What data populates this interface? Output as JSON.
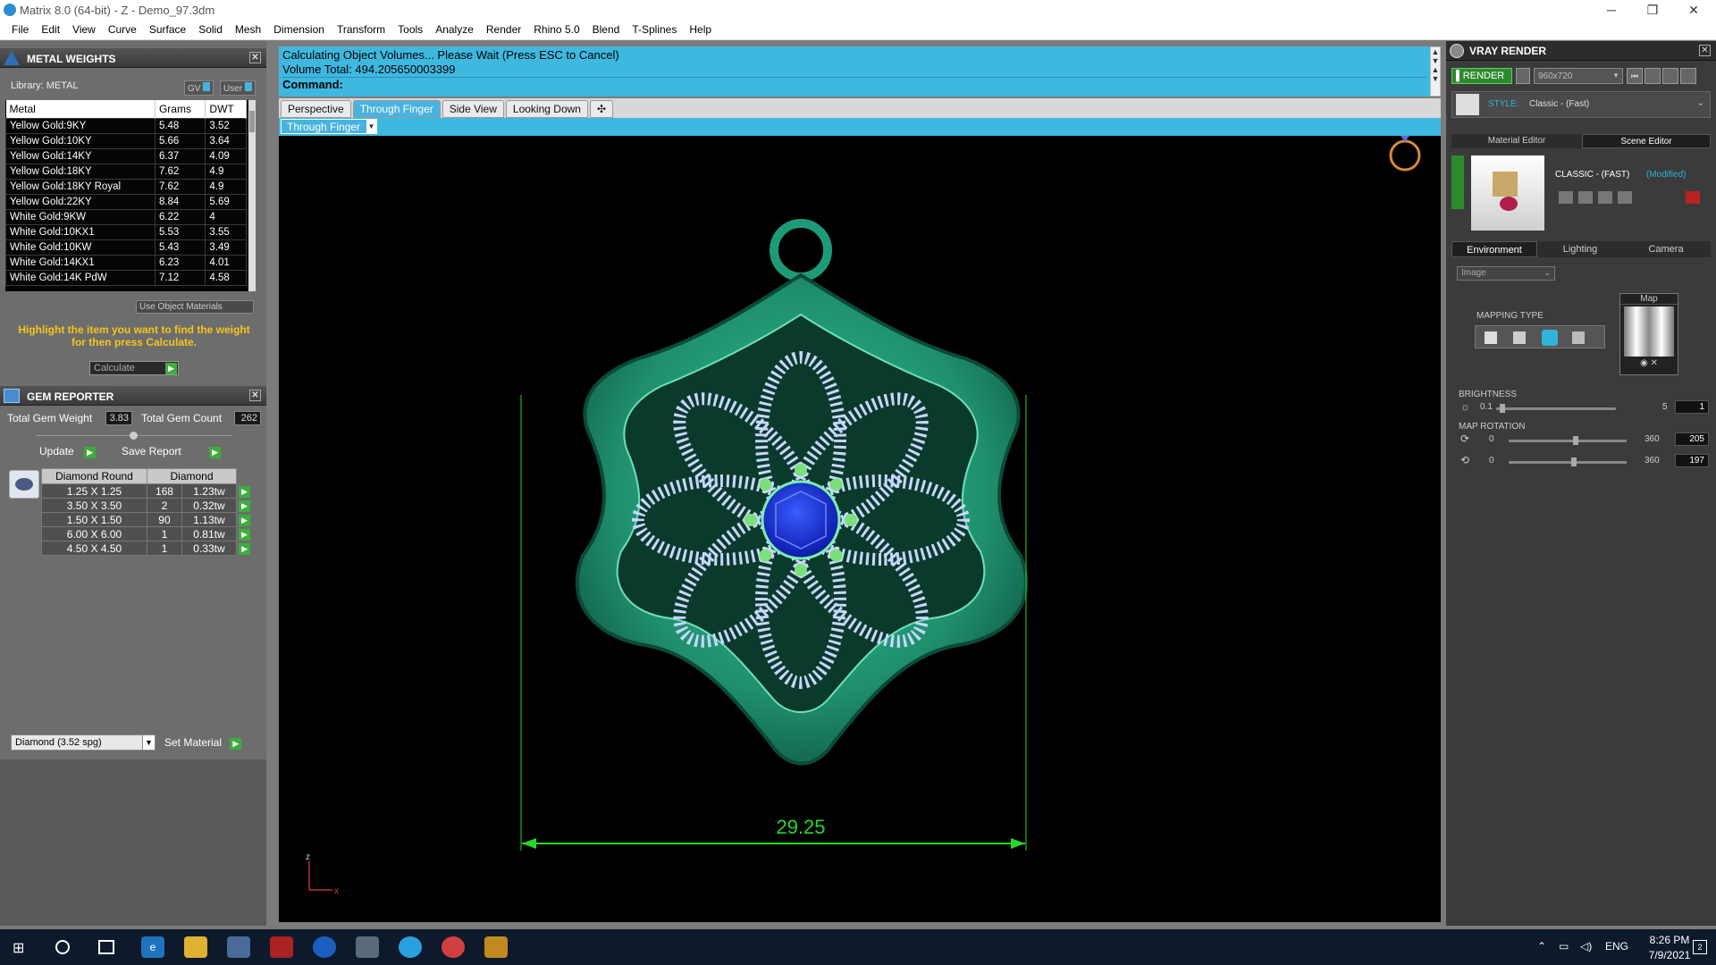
{
  "window": {
    "title": "Matrix 8.0 (64-bit) - Z - Demo_97.3dm",
    "minimize": "─",
    "restore": "❐",
    "close": "✕"
  },
  "menu": [
    "File",
    "Edit",
    "View",
    "Curve",
    "Surface",
    "Solid",
    "Mesh",
    "Dimension",
    "Transform",
    "Tools",
    "Analyze",
    "Render",
    "Rhino 5.0",
    "Blend",
    "T-Splines",
    "Help"
  ],
  "metal_weights": {
    "title": "METAL WEIGHTS",
    "library_label": "Library: METAL",
    "gv_btn": "GV",
    "user_btn": "User",
    "columns": [
      "Metal",
      "Grams",
      "DWT"
    ],
    "rows": [
      [
        "Yellow Gold:9KY",
        "5.48",
        "3.52"
      ],
      [
        "Yellow Gold:10KY",
        "5.66",
        "3.64"
      ],
      [
        "Yellow Gold:14KY",
        "6.37",
        "4.09"
      ],
      [
        "Yellow Gold:18KY",
        "7.62",
        "4.9"
      ],
      [
        "Yellow Gold:18KY Royal",
        "7.62",
        "4.9"
      ],
      [
        "Yellow Gold:22KY",
        "8.84",
        "5.69"
      ],
      [
        "White Gold:9KW",
        "6.22",
        "4"
      ],
      [
        "White Gold:10KX1",
        "5.53",
        "3.55"
      ],
      [
        "White Gold:10KW",
        "5.43",
        "3.49"
      ],
      [
        "White Gold:14KX1",
        "6.23",
        "4.01"
      ],
      [
        "White Gold:14K PdW",
        "7.12",
        "4.58"
      ]
    ],
    "use_object_materials": "Use Object Materials",
    "hint": "Highlight the item you want to find the weight for then press Calculate.",
    "calculate": "Calculate"
  },
  "gem_reporter": {
    "title": "GEM REPORTER",
    "total_weight_label": "Total Gem Weight",
    "total_weight": "3.83",
    "total_count_label": "Total Gem Count",
    "total_count": "262",
    "update": "Update",
    "save_report": "Save Report",
    "col_shape": "Diamond Round",
    "col_material": "Diamond",
    "rows": [
      [
        "1.25 X 1.25",
        "168",
        "1.23tw"
      ],
      [
        "3.50 X 3.50",
        "2",
        "0.32tw"
      ],
      [
        "1.50 X 1.50",
        "90",
        "1.13tw"
      ],
      [
        "6.00 X 6.00",
        "1",
        "0.81tw"
      ],
      [
        "4.50 X 4.50",
        "1",
        "0.33tw"
      ]
    ],
    "material_select": "Diamond    (3.52 spg)",
    "set_material": "Set Material"
  },
  "command": {
    "line1": "Calculating Object Volumes... Please Wait (Press ESC to Cancel)",
    "line2": "Volume Total: 494.205650003399",
    "prompt": "Command:"
  },
  "viewport": {
    "tabs": [
      "Perspective",
      "Through Finger",
      "Side View",
      "Looking Down"
    ],
    "active_tab": "Through Finger",
    "add_tab": "✣",
    "label": "Through Finger",
    "dimension": "29.25",
    "axis_z": "z",
    "axis_x": "x"
  },
  "vray": {
    "title": "VRAY RENDER",
    "render_btn": "RENDER",
    "resolution": "960x720",
    "style_label": "STYLE:",
    "style_value": "Classic - (Fast)",
    "tab_material": "Material Editor",
    "tab_scene": "Scene Editor",
    "preset_name": "CLASSIC - (FAST)",
    "preset_modified": "(Modified)",
    "env_tabs": [
      "Environment",
      "Lighting",
      "Camera"
    ],
    "image_select": "Image",
    "map_label": "Map",
    "mapping_type": "MAPPING TYPE",
    "brightness": "BRIGHTNESS",
    "bright_min": "0.1",
    "bright_max": "5",
    "bright_val": "1",
    "map_rotation": "MAP ROTATION",
    "rot_min": "0",
    "rot_max": "360",
    "rot1_val": "205",
    "rot2_min": "0",
    "rot2_max": "360",
    "rot2_val": "197",
    "brightness_fraction": 0.05,
    "rot1_fraction": 0.57,
    "rot2_fraction": 0.55
  },
  "taskbar": {
    "lang": "ENG",
    "time": "8:26 PM",
    "date": "7/9/2021",
    "notif": "2"
  }
}
